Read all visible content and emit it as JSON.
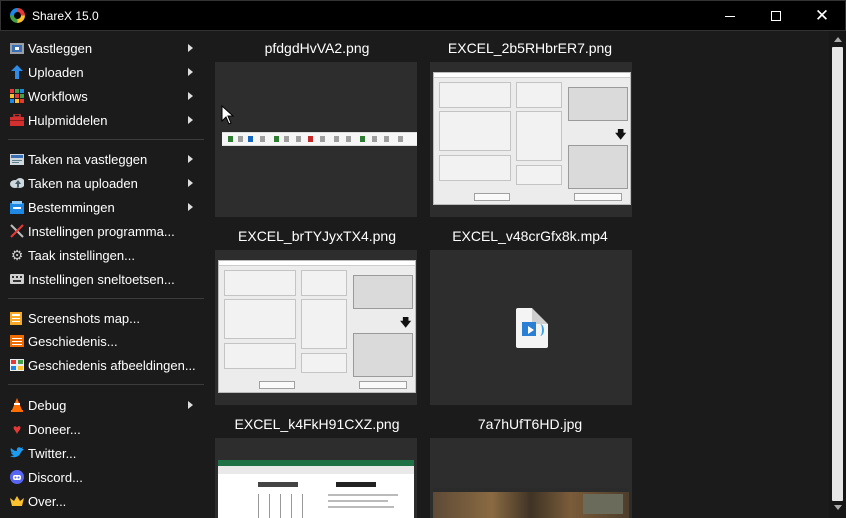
{
  "window": {
    "title": "ShareX 15.0"
  },
  "menu": {
    "items": [
      {
        "label": "Vastleggen",
        "icon": "capture-icon",
        "submenu": true
      },
      {
        "label": "Uploaden",
        "icon": "upload-arrow-icon",
        "submenu": true
      },
      {
        "label": "Workflows",
        "icon": "workflows-grid-icon",
        "submenu": true
      },
      {
        "label": "Hulpmiddelen",
        "icon": "toolbox-icon",
        "submenu": true
      },
      {
        "label": "Taken na vastleggen",
        "icon": "after-capture-icon",
        "submenu": true
      },
      {
        "label": "Taken na uploaden",
        "icon": "cloud-upload-icon",
        "submenu": true
      },
      {
        "label": "Bestemmingen",
        "icon": "destinations-icon",
        "submenu": true
      },
      {
        "label": "Instellingen programma...",
        "icon": "wrench-screwdriver-icon",
        "submenu": false
      },
      {
        "label": "Taak instellingen...",
        "icon": "gear-icon",
        "submenu": false
      },
      {
        "label": "Instellingen sneltoetsen...",
        "icon": "keyboard-icon",
        "submenu": false
      },
      {
        "label": "Screenshots map...",
        "icon": "folder-icon",
        "submenu": false
      },
      {
        "label": "Geschiedenis...",
        "icon": "history-icon",
        "submenu": false
      },
      {
        "label": "Geschiedenis afbeeldingen...",
        "icon": "image-history-icon",
        "submenu": false
      },
      {
        "label": "Debug",
        "icon": "traffic-cone-icon",
        "submenu": true
      },
      {
        "label": "Doneer...",
        "icon": "heart-icon",
        "submenu": false
      },
      {
        "label": "Twitter...",
        "icon": "twitter-bird-icon",
        "submenu": false
      },
      {
        "label": "Discord...",
        "icon": "discord-icon",
        "submenu": false
      },
      {
        "label": "Over...",
        "icon": "crown-icon",
        "submenu": false
      }
    ]
  },
  "thumbnails": [
    {
      "filename": "pfdgdHvVA2.png"
    },
    {
      "filename": "EXCEL_2b5RHbrER7.png"
    },
    {
      "filename": "EXCEL_brTYJyxTX4.png"
    },
    {
      "filename": "EXCEL_v48crGfx8k.mp4"
    },
    {
      "filename": "EXCEL_k4FkH91CXZ.png"
    },
    {
      "filename": "7a7hUfT6HD.jpg"
    }
  ],
  "colors": {
    "background": "#1b1b1b",
    "thumbnail_bg": "#2d2d2d",
    "titlebar": "#000000"
  }
}
